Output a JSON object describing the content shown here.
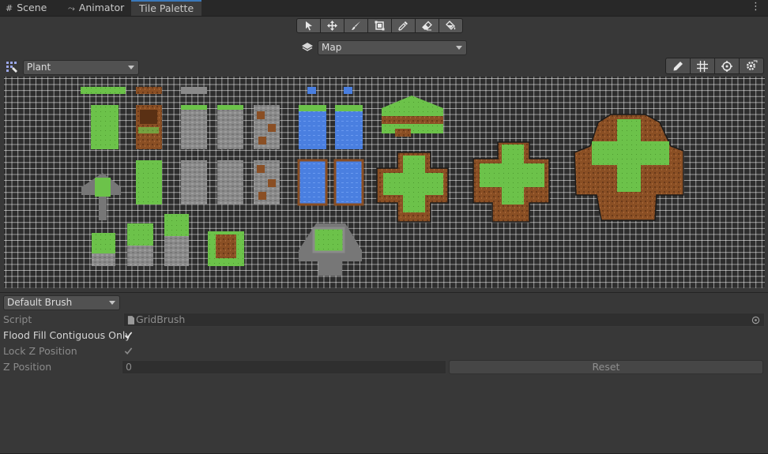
{
  "tabs": [
    {
      "label": "Scene",
      "icon": "grid-icon",
      "active": false
    },
    {
      "label": "Animator",
      "icon": "animator-icon",
      "active": false
    },
    {
      "label": "Tile Palette",
      "active": true
    }
  ],
  "tools": [
    "select-tool",
    "move-tool",
    "paint-tool",
    "box-fill-tool",
    "pick-tool",
    "erase-tool",
    "fill-tool"
  ],
  "target_tilemap": {
    "selected": "Map"
  },
  "palette": {
    "selected": "Plant"
  },
  "edit_tools": [
    "edit-pencil",
    "grid-toggle",
    "gizmo-toggle",
    "palette-settings"
  ],
  "brush": {
    "selected": "Default Brush"
  },
  "properties": {
    "script_label": "Script",
    "script_value": "GridBrush",
    "flood_fill_label": "Flood Fill Contiguous Only",
    "flood_fill_checked": true,
    "lock_z_label": "Lock Z Position",
    "lock_z_checked": true,
    "z_position_label": "Z Position",
    "z_position_value": "0",
    "reset_label": "Reset"
  },
  "colors": {
    "accent": "#3a79bb",
    "grass": "#6cc24a",
    "dirt": "#8a4f24",
    "water": "#4a7fe0",
    "stone": "#8a8a8a"
  }
}
